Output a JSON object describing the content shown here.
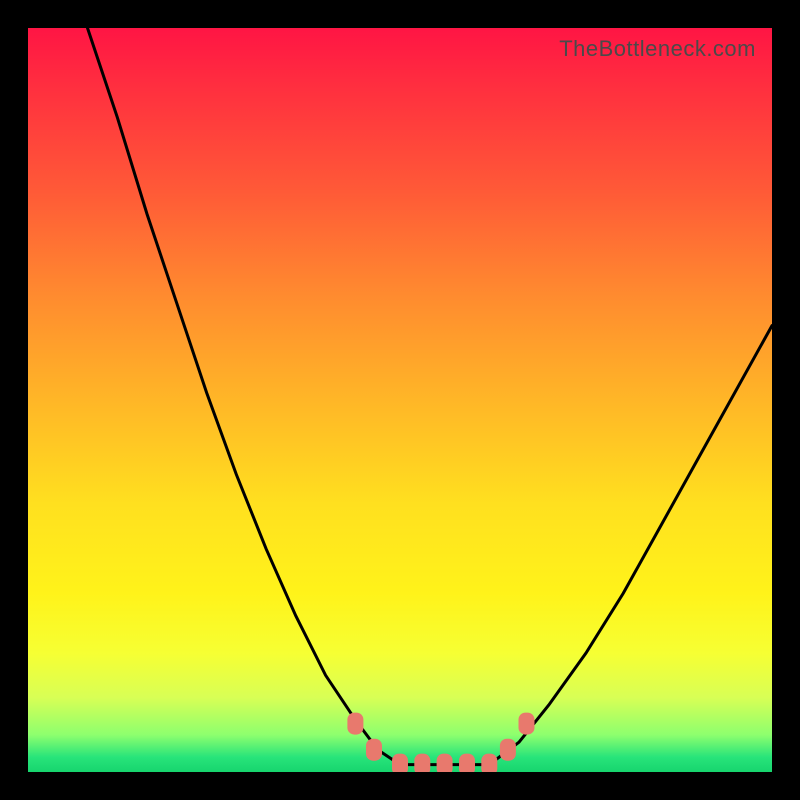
{
  "watermark": "TheBottleneck.com",
  "chart_data": {
    "type": "line",
    "title": "",
    "xlabel": "",
    "ylabel": "",
    "xlim": [
      0,
      100
    ],
    "ylim": [
      0,
      100
    ],
    "series": [
      {
        "name": "left-curve",
        "x": [
          8,
          12,
          16,
          20,
          24,
          28,
          32,
          36,
          40,
          44,
          47,
          50
        ],
        "y": [
          100,
          88,
          75,
          63,
          51,
          40,
          30,
          21,
          13,
          7,
          3,
          1
        ]
      },
      {
        "name": "bottom-flat",
        "x": [
          50,
          53,
          56,
          59,
          62
        ],
        "y": [
          1,
          1,
          1,
          1,
          1
        ]
      },
      {
        "name": "right-curve",
        "x": [
          62,
          66,
          70,
          75,
          80,
          85,
          90,
          95,
          100
        ],
        "y": [
          1,
          4,
          9,
          16,
          24,
          33,
          42,
          51,
          60
        ]
      }
    ],
    "markers": [
      {
        "name": "bead-left-upper",
        "x": 44.0,
        "y": 6.5
      },
      {
        "name": "bead-left-lower",
        "x": 46.5,
        "y": 3.0
      },
      {
        "name": "bead-bottom-1",
        "x": 50.0,
        "y": 1.0
      },
      {
        "name": "bead-bottom-2",
        "x": 53.0,
        "y": 1.0
      },
      {
        "name": "bead-bottom-3",
        "x": 56.0,
        "y": 1.0
      },
      {
        "name": "bead-bottom-4",
        "x": 59.0,
        "y": 1.0
      },
      {
        "name": "bead-bottom-5",
        "x": 62.0,
        "y": 1.0
      },
      {
        "name": "bead-right-lower",
        "x": 64.5,
        "y": 3.0
      },
      {
        "name": "bead-right-upper",
        "x": 67.0,
        "y": 6.5
      }
    ],
    "gradient_note": "background encodes value top=red(high) bottom=green(low)"
  }
}
